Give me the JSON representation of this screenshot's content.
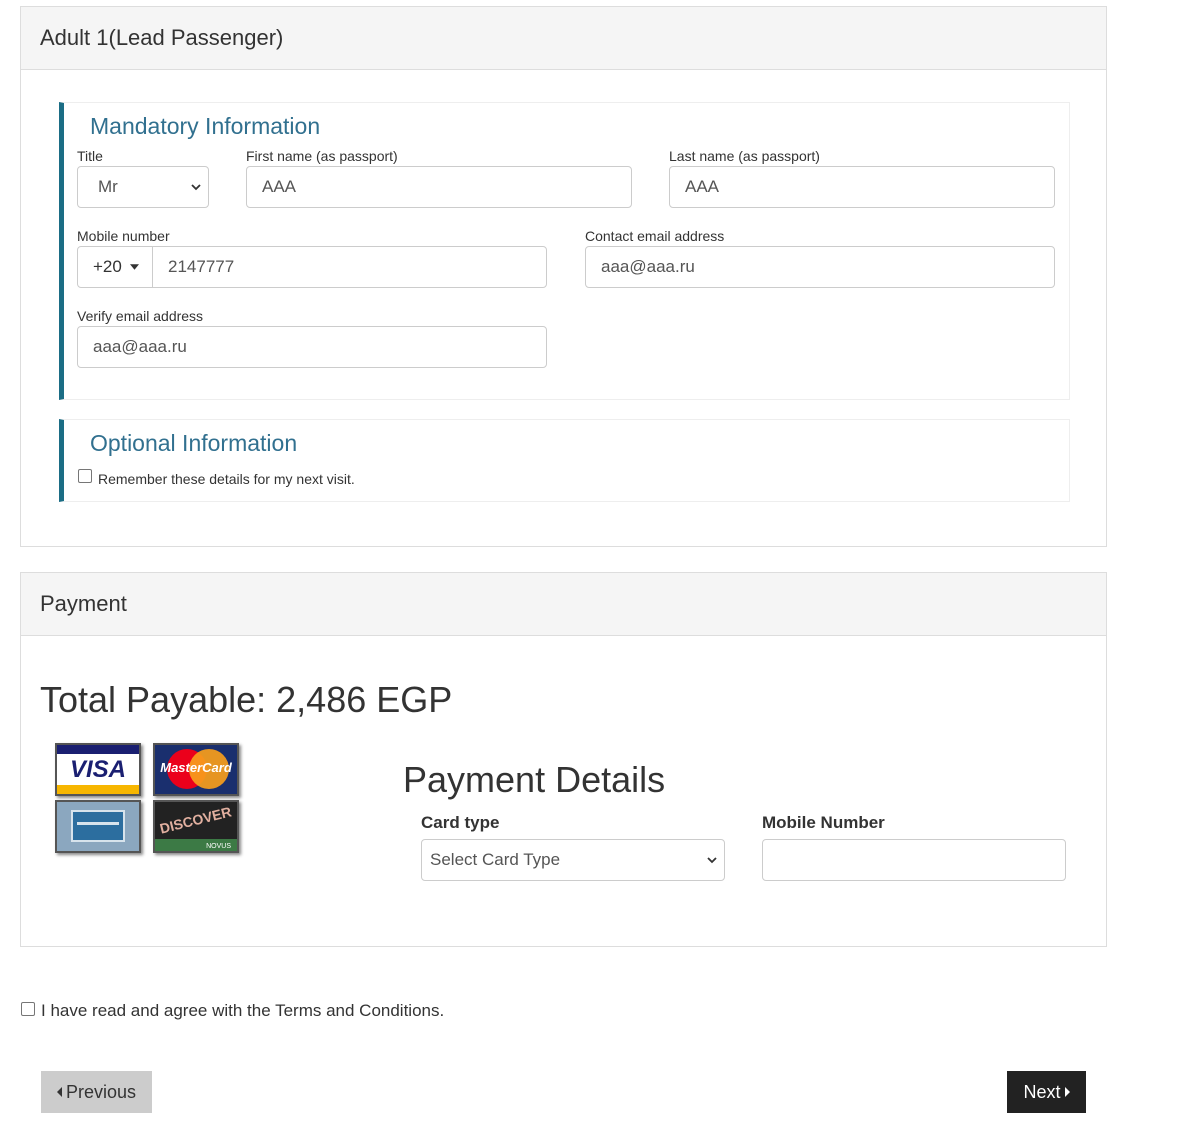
{
  "passenger_panel": {
    "heading": "Adult 1(Lead Passenger)"
  },
  "mandatory": {
    "title": "Mandatory Information",
    "title_label": "Title",
    "title_value": "Mr",
    "first_name_label": "First name (as passport)",
    "first_name_value": "AAA",
    "last_name_label": "Last name (as passport)",
    "last_name_value": "AAA",
    "mobile_label": "Mobile number",
    "mobile_code": "+20",
    "mobile_value": "2147777",
    "email_label": "Contact email address",
    "email_value": "aaa@aaa.ru",
    "verify_email_label": "Verify email address",
    "verify_email_value": "aaa@aaa.ru"
  },
  "optional": {
    "title": "Optional Information",
    "remember_label": "Remember these details for my next visit."
  },
  "payment_panel": {
    "heading": "Payment",
    "total_label": "Total Payable: 2,486 EGP",
    "details_title": "Payment Details",
    "card_type_label": "Card type",
    "card_type_value": "Select Card Type",
    "mobile_number_label": "Mobile Number",
    "mobile_number_value": "",
    "cards": {
      "visa_text": "VISA",
      "mastercard_text": "MasterCard",
      "discover_text": "DISCOVER",
      "discover_sub": "NOVUS"
    }
  },
  "terms": {
    "label": "I have read and agree with the Terms and Conditions."
  },
  "nav": {
    "previous_label": "Previous",
    "next_label": "Next"
  },
  "colors": {
    "accent": "#1b6d85",
    "section_title": "#31708f",
    "panel_heading_bg": "#f5f5f5",
    "next_bg": "#222222",
    "previous_bg": "#cccccc"
  }
}
